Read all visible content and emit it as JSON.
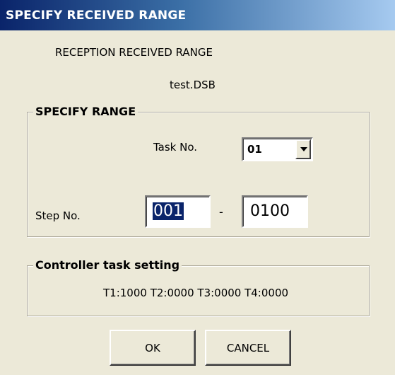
{
  "window": {
    "title": "SPECIFY RECEIVED RANGE"
  },
  "header": {
    "caption": "RECEPTION RECEIVED RANGE",
    "filename": "test.DSB"
  },
  "specify_range": {
    "group_title": "SPECIFY RANGE",
    "task_label": "Task No.",
    "task_value": "01",
    "step_label": "Step No.",
    "step_from": "001",
    "separator": "-",
    "step_to": "0100"
  },
  "controller": {
    "group_title": "Controller task setting",
    "text": "T1:1000 T2:0000 T3:0000 T4:0000"
  },
  "buttons": {
    "ok": "OK",
    "cancel": "CANCEL"
  },
  "colors": {
    "titlebar_start": "#0a246a",
    "titlebar_end": "#a6caf0",
    "face": "#ece9d8",
    "selection": "#0a246a"
  }
}
